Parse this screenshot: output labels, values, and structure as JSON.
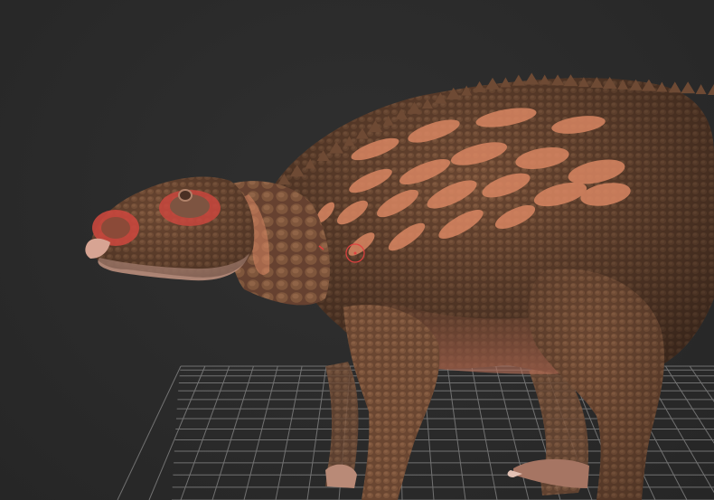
{
  "viewport": {
    "background": "#2b2b2b",
    "grid_color": "#8a8a8a",
    "model": {
      "subject": "dinosaur-sculpt",
      "skin_base": "#6e4a34",
      "skin_dark": "#4b3124",
      "stripe_color": "#d98662",
      "eye_ring_color": "#d8473f",
      "belly_color": "#b06a56"
    },
    "cursor_icon": "brush-cursor-circle",
    "floor_grid": "visible"
  }
}
